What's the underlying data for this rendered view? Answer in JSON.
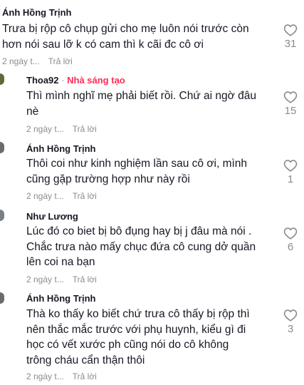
{
  "comments": [
    {
      "author": "Ánh Hồng Trịnh",
      "creator_badge": "",
      "lines": [
        "Trưa bị rộp cô chụp gửi cho mẹ luôn nói trước còn",
        "hơn nói sau lỡ k có cam thì k cãi đc cô ơi"
      ],
      "time": "2 ngày t...",
      "reply_label": "Trả lời",
      "likes": "31"
    },
    {
      "author": "Thoa92",
      "separator": "·",
      "creator_badge": "Nhà sáng tạo",
      "lines": [
        "Thì mình nghĩ mẹ phải biết rồi. Chứ ai ngờ đâu",
        "nè"
      ],
      "time": "2 ngày t...",
      "reply_label": "Trả lời",
      "likes": "15"
    },
    {
      "author": "Ánh Hồng Trịnh",
      "creator_badge": "",
      "lines": [
        "Thôi coi như kinh nghiệm lần sau cô ơi, mình",
        "cũng gặp trường hợp như này rồi"
      ],
      "time": "2 ngày t...",
      "reply_label": "Trả lời",
      "likes": "1"
    },
    {
      "author": "Như Lương",
      "creator_badge": "",
      "lines": [
        "Lúc đó co biet bị bô đụng hay bị j đâu mà nói .",
        "Chắc trưa nào mấy chục đứa cô cung dở quần",
        "lên coi na bạn"
      ],
      "time": "2 ngày t...",
      "reply_label": "Trả lời",
      "likes": "6"
    },
    {
      "author": "Ánh Hồng Trịnh",
      "creator_badge": "",
      "lines": [
        "Thà ko thấy ko biết chứ trưa cô thấy bị rộp thì",
        "nên thắc mắc trước với phụ huynh, kiểu gì đi",
        "học có vết xước ph cũng nói do cô không",
        "trông cháu cẩn thận thôi"
      ],
      "time": "2 ngày t...",
      "reply_label": "Trả lời",
      "likes": "3"
    }
  ],
  "colors": {
    "text": "#161823",
    "muted": "#8a8b91",
    "creator": "#fe2c55",
    "avatar_green": "#5b6b3c"
  },
  "icons": {
    "like": "heart-outline-icon"
  }
}
